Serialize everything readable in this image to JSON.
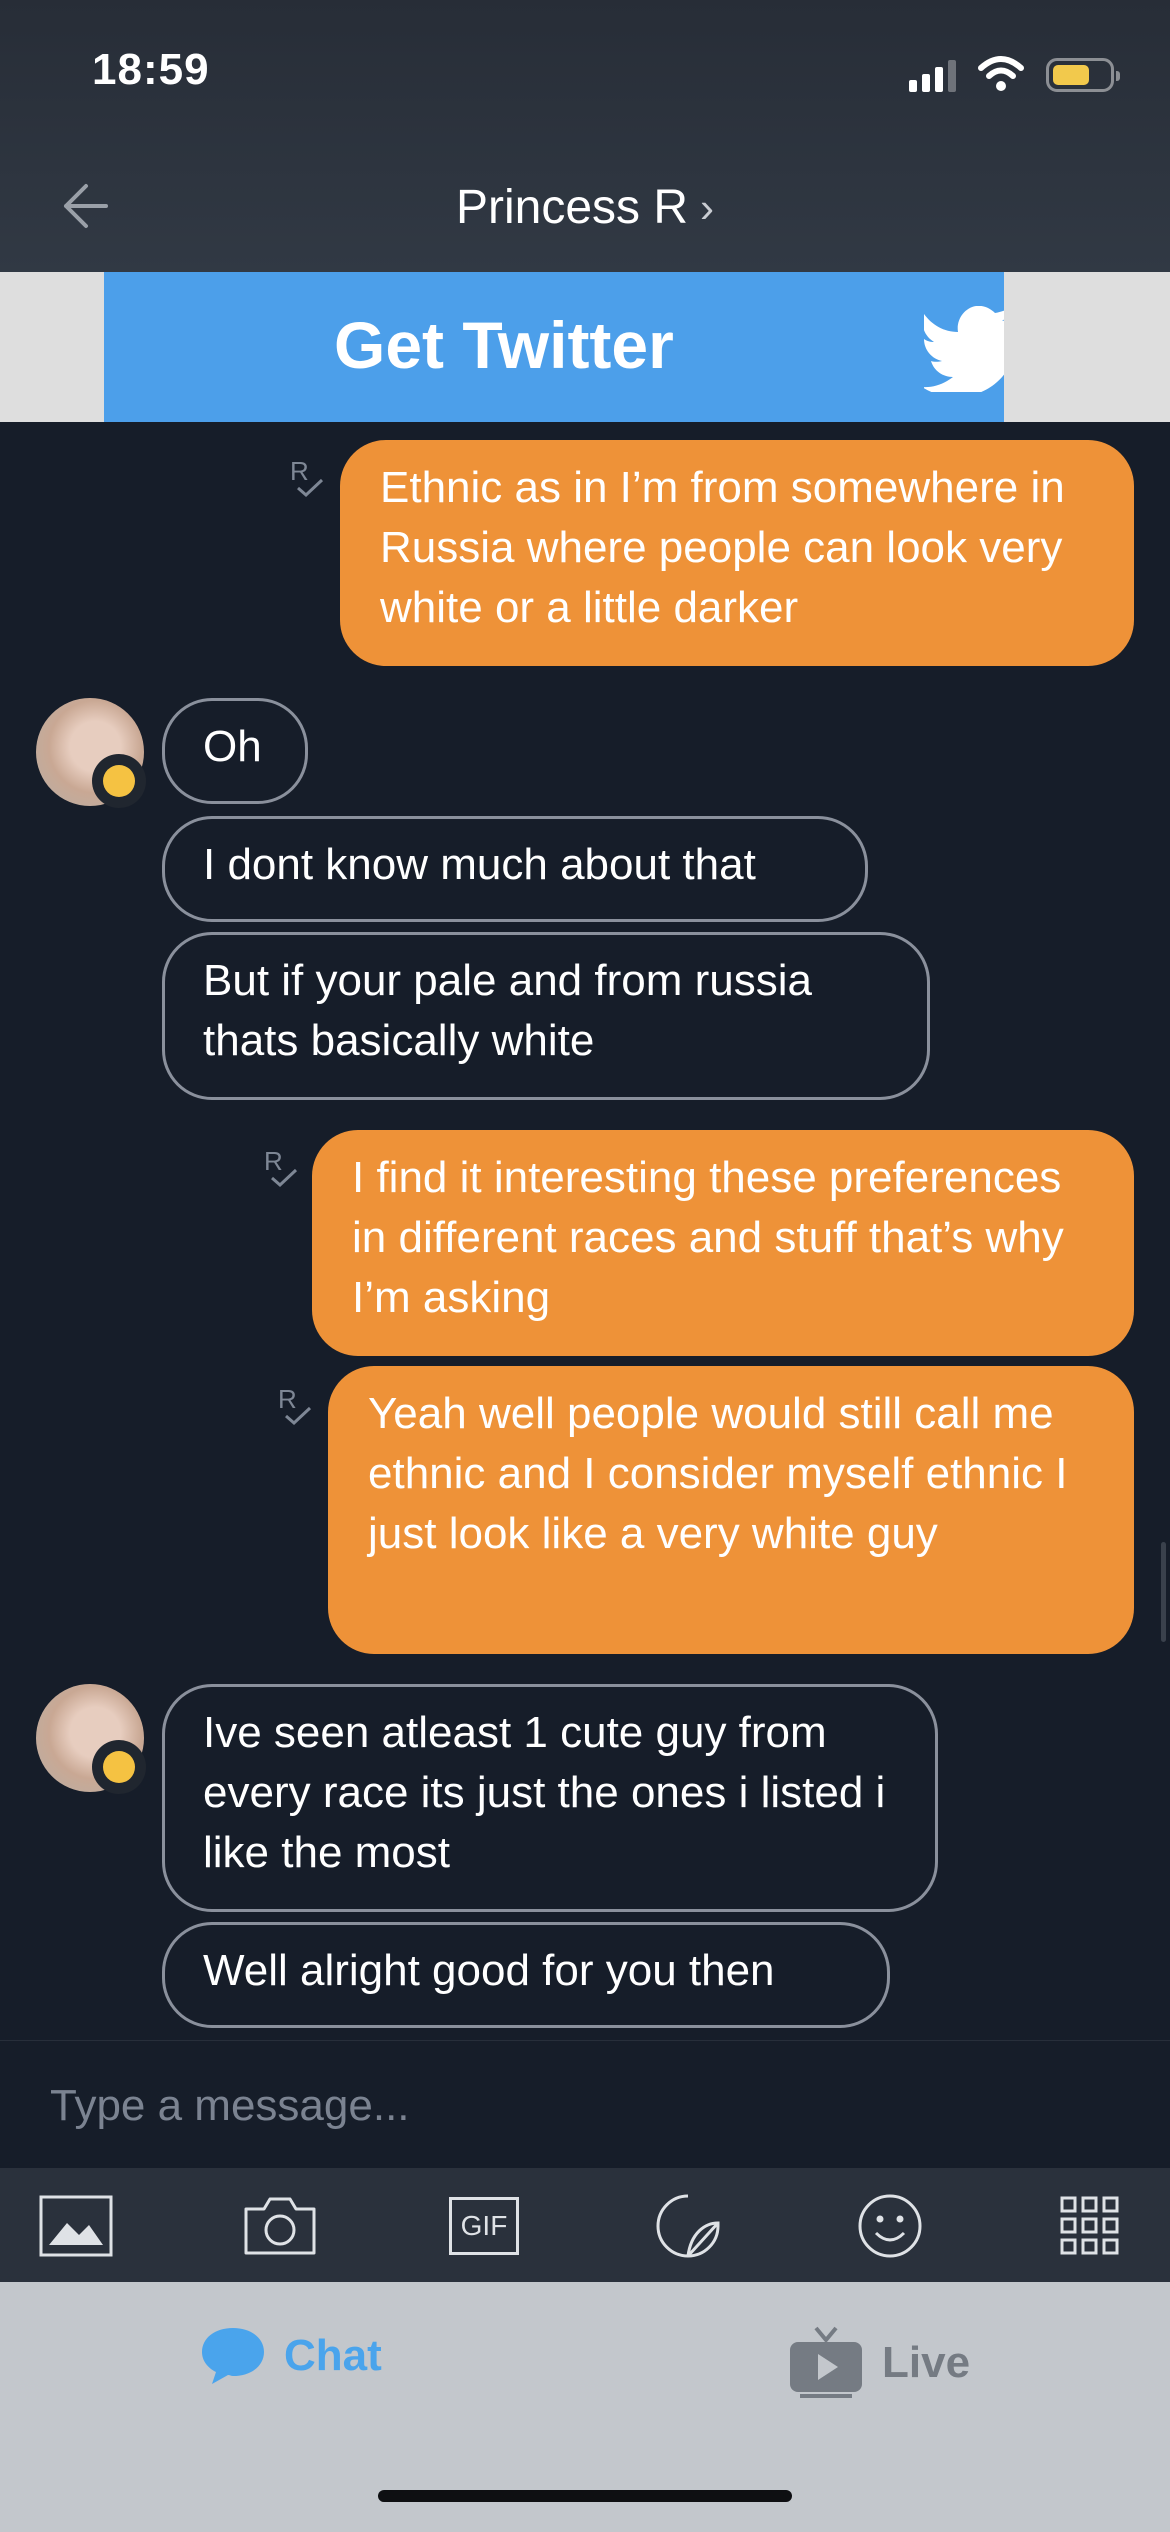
{
  "status_bar": {
    "time": "18:59",
    "icons": [
      "signal-icon",
      "wifi-icon",
      "battery-icon"
    ],
    "battery_color": "#f2c94c"
  },
  "header": {
    "back_icon": "back-arrow-icon",
    "title": "Princess R",
    "chevron": "›"
  },
  "ad": {
    "text": "Get Twitter",
    "icon": "twitter-bird-icon",
    "background": "#4c9fea"
  },
  "messages": [
    {
      "side": "out",
      "receipt": "R",
      "text": "Ethnic as in I’m from somewhere in Russia where people can look very white or a little darker"
    },
    {
      "side": "in",
      "text": "Oh"
    },
    {
      "side": "in",
      "text": "I dont know much about that"
    },
    {
      "side": "in",
      "text": "But if your pale and from russia thats basically white"
    },
    {
      "side": "out",
      "receipt": "R",
      "text": "I find it interesting these preferences in different races and stuff that’s why I’m asking"
    },
    {
      "side": "out",
      "receipt": "R",
      "text": "Yeah well people would still call me ethnic and I consider myself ethnic I just look like a very white guy"
    },
    {
      "side": "in",
      "text": "Ive seen atleast 1 cute guy from every race its just the ones i listed i like the most"
    },
    {
      "side": "in",
      "text": "Well alright good for you then"
    }
  ],
  "composer": {
    "placeholder": "Type a message..."
  },
  "toolbar": {
    "gif_label": "GIF",
    "icons": [
      "image-icon",
      "camera-icon",
      "gif-icon",
      "sticker-icon",
      "emoji-icon",
      "apps-grid-icon"
    ]
  },
  "tabs": {
    "chat": "Chat",
    "live": "Live"
  },
  "colors": {
    "outgoing": "#ee9238",
    "accent": "#4aa4ec",
    "background": "#161d29"
  }
}
